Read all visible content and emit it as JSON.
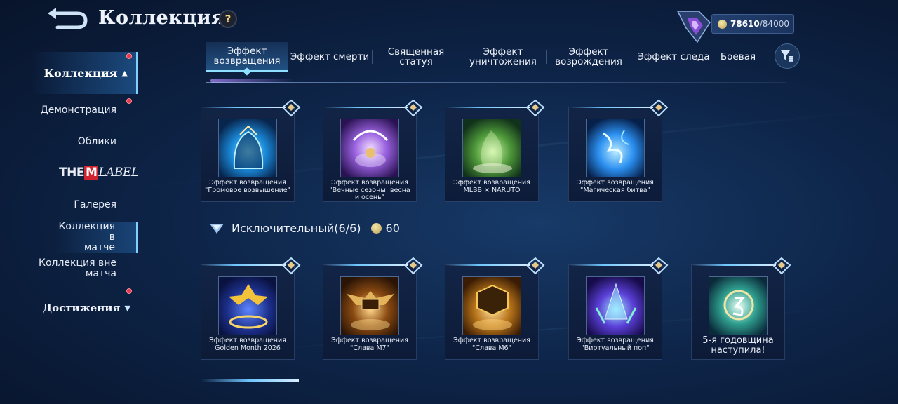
{
  "header": {
    "title": "Коллекция",
    "help_label": "?"
  },
  "points": {
    "current": "78610",
    "separator": "/",
    "max": "84000"
  },
  "sidebar": {
    "active_group": "Коллекция",
    "items": [
      {
        "label": "Демонстрация"
      },
      {
        "label": "Облики"
      },
      {
        "label_the": "THE",
        "label_m": "M",
        "label_lab": "LABEL"
      },
      {
        "label": "Галерея"
      },
      {
        "label_line1": "Коллекция в",
        "label_line2": "матче"
      },
      {
        "label_line1": "Коллекция вне",
        "label_line2": "матча"
      }
    ],
    "achievements": "Достижения"
  },
  "tabs": [
    {
      "line1": "Эффект",
      "line2": "возвращения",
      "active": true
    },
    {
      "line1": "Эффект смерти"
    },
    {
      "line1": "Священная",
      "line2": "статуя"
    },
    {
      "line1": "Эффект",
      "line2": "уничтожения"
    },
    {
      "line1": "Эффект",
      "line2": "возрождения"
    },
    {
      "line1": "Эффект следа"
    },
    {
      "line1": "Боевая"
    }
  ],
  "section_top_cards": [
    {
      "line1": "Эффект возвращения",
      "line2": "\"Громовое возвышение\"",
      "color": "#1aa7e8"
    },
    {
      "line1": "Эффект возвращения",
      "line2": "\"Вечные сезоны: весна и осень\"",
      "color": "#8a5cd6"
    },
    {
      "line1": "Эффект возвращения",
      "line2": "MLBB × NARUTO",
      "color": "#4e9a3a"
    },
    {
      "line1": "Эффект возвращения",
      "line2": "\"Магическая битва\"",
      "color": "#2b8ff0"
    }
  ],
  "section_exclusive": {
    "title": "Исключительный(6/6)",
    "points": "60",
    "cards": [
      {
        "line1": "Эффект возвращения",
        "line2": "Golden Month 2026",
        "color": "#e0a820"
      },
      {
        "line1": "Эффект возвращения",
        "line2": "\"Слава М7\"",
        "color": "#d08a2a"
      },
      {
        "line1": "Эффект возвращения",
        "line2": "\"Слава М6\"",
        "color": "#e39a1c"
      },
      {
        "line1": "Эффект возвращения",
        "line2": "\"Виртуальный поп\"",
        "color": "#5a7ff0"
      },
      {
        "big_line1": "5-я годовщина",
        "big_line2": "наступила!",
        "color": "#3bc2a8"
      }
    ]
  }
}
